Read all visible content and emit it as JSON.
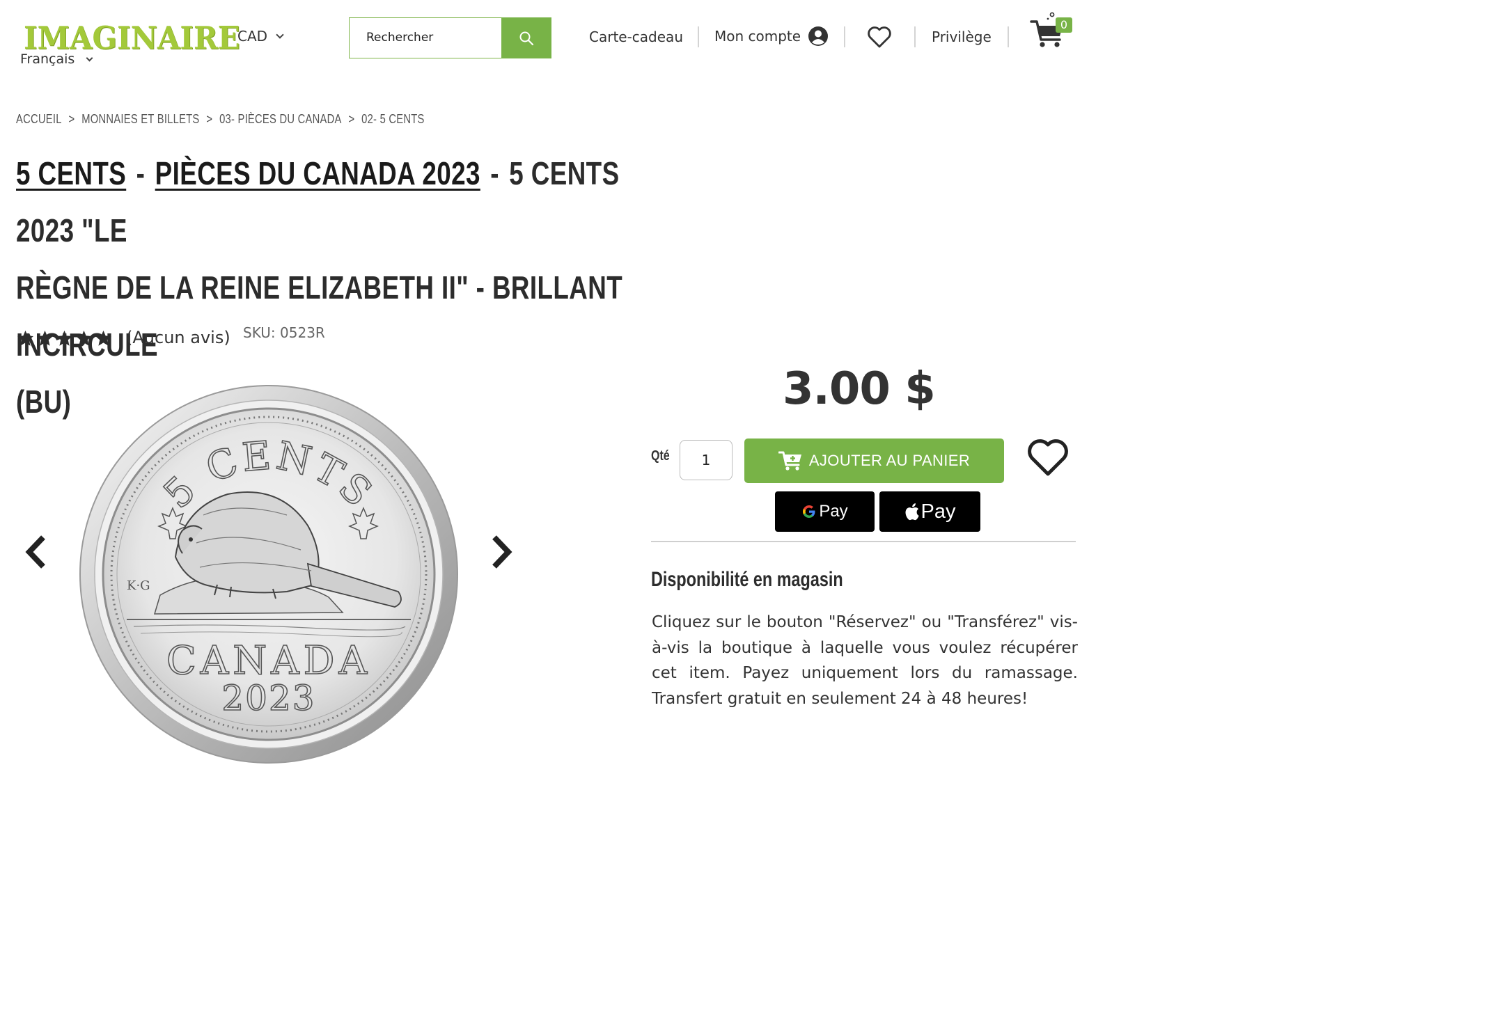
{
  "header": {
    "logo_text": "IMAGINAIRE",
    "currency": "CAD",
    "language": "Français",
    "search_placeholder": "Rechercher",
    "nav": {
      "gift_card": "Carte-cadeau",
      "account": "Mon compte",
      "privilege": "Privilège"
    },
    "cart_count": "0"
  },
  "breadcrumb": [
    "ACCUEIL",
    "MONNAIES ET BILLETS",
    "03- PIÈCES DU CANADA",
    "02- 5 CENTS"
  ],
  "breadcrumb_sep": ">",
  "title": {
    "link1": "5 CENTS",
    "link2": "PIÈCES DU CANADA 2023",
    "separator": "-",
    "line1_rest": "5 CENTS 2023 \"LE",
    "line2": "RÈGNE DE LA REINE ELIZABETH II\" - BRILLANT INCIRCULE",
    "line3": "(BU)"
  },
  "rating": {
    "stars": 5,
    "reviews_text": "(Aucun avis)",
    "sku_label": "SKU:",
    "sku_value": "0523R"
  },
  "coin": {
    "top_text": "5 CENTS",
    "country": "CANADA",
    "year": "2023",
    "initials": "K·G"
  },
  "buy_box": {
    "price": "3.00 $",
    "qty_label": "Qté",
    "qty_value": "1",
    "add_to_cart": "AJOUTER AU PANIER",
    "gpay": "Pay",
    "applepay": "Pay"
  },
  "availability": {
    "title": "Disponibilité en magasin",
    "text": "Cliquez sur le bouton \"Réservez\" ou \"Transférez\" vis-à-vis la boutique à laquelle vous voulez récupérer cet item. Payez uniquement lors du ramassage. Transfert gratuit en seulement 24 à 48 heures!"
  },
  "colors": {
    "brand_green": "#78b347",
    "logo_green": "#a3c93a",
    "text_dark": "#333333"
  }
}
